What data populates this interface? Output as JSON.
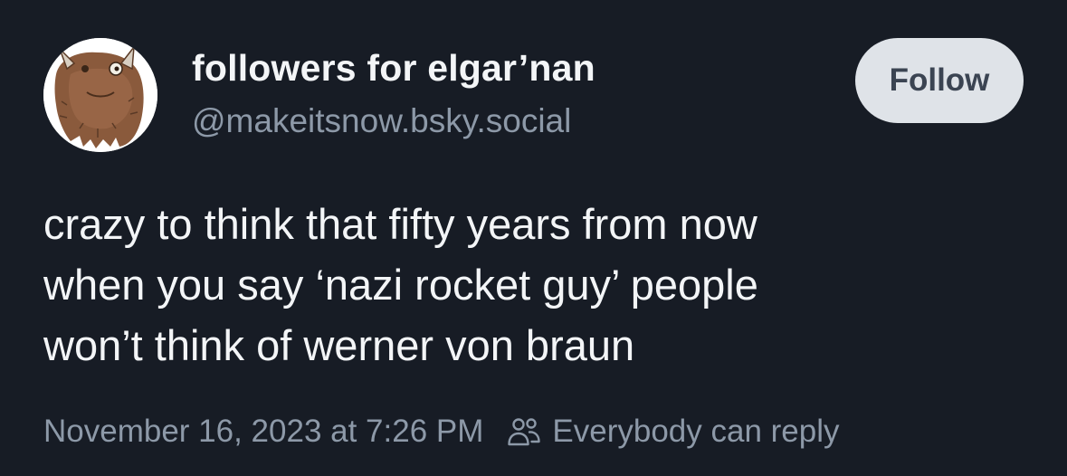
{
  "author": {
    "display_name": "followers for elgar’nan",
    "handle": "@makeitsnow.bsky.social",
    "avatar_icon": "furry-creature-avatar"
  },
  "follow_button": {
    "label": "Follow"
  },
  "post": {
    "lines": [
      "crazy to think that fifty years from now",
      "when you say ‘nazi rocket guy’ people",
      "won’t think of werner von braun"
    ],
    "timestamp": "November 16, 2023 at 7:26 PM",
    "reply_setting": "Everybody can reply",
    "reply_setting_icon": "people-icon"
  },
  "colors": {
    "background": "#171c25",
    "primary_text": "#f3f5f7",
    "secondary_text": "#8d99a8",
    "follow_button_bg": "#dfe3e8",
    "follow_button_text": "#3b4452"
  }
}
